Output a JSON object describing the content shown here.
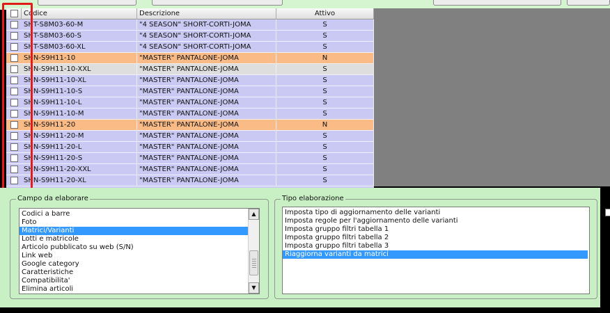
{
  "grid": {
    "columns": {
      "codice": "Codice",
      "descrizione": "Descrizione",
      "attivo": "Attivo"
    },
    "rows": [
      {
        "codice": "SHT-S8M03-60-M",
        "descrizione": "\"4 SEASON\"  SHORT-CORTI-JOMA",
        "attivo": "S",
        "state": "active"
      },
      {
        "codice": "SHT-S8M03-60-S",
        "descrizione": "\"4 SEASON\"  SHORT-CORTI-JOMA",
        "attivo": "S",
        "state": "active"
      },
      {
        "codice": "SHT-S8M03-60-XL",
        "descrizione": "\"4 SEASON\"  SHORT-CORTI-JOMA",
        "attivo": "S",
        "state": "active"
      },
      {
        "codice": "SHN-S9H11-10",
        "descrizione": "\"MASTER\"  PANTALONE-JOMA",
        "attivo": "N",
        "state": "inactive"
      },
      {
        "codice": "SHN-S9H11-10-XXL",
        "descrizione": "\"MASTER\"  PANTALONE-JOMA",
        "attivo": "S",
        "state": "current"
      },
      {
        "codice": "SHN-S9H11-10-XL",
        "descrizione": "\"MASTER\"  PANTALONE-JOMA",
        "attivo": "S",
        "state": "active"
      },
      {
        "codice": "SHN-S9H11-10-S",
        "descrizione": "\"MASTER\"  PANTALONE-JOMA",
        "attivo": "S",
        "state": "active"
      },
      {
        "codice": "SHN-S9H11-10-L",
        "descrizione": "\"MASTER\"  PANTALONE-JOMA",
        "attivo": "S",
        "state": "active"
      },
      {
        "codice": "SHN-S9H11-10-M",
        "descrizione": "\"MASTER\"  PANTALONE-JOMA",
        "attivo": "S",
        "state": "active"
      },
      {
        "codice": "SHN-S9H11-20",
        "descrizione": "\"MASTER\"  PANTALONE-JOMA",
        "attivo": "N",
        "state": "inactive"
      },
      {
        "codice": "SHN-S9H11-20-M",
        "descrizione": "\"MASTER\"  PANTALONE-JOMA",
        "attivo": "S",
        "state": "active"
      },
      {
        "codice": "SHN-S9H11-20-L",
        "descrizione": "\"MASTER\"  PANTALONE-JOMA",
        "attivo": "S",
        "state": "active"
      },
      {
        "codice": "SHN-S9H11-20-S",
        "descrizione": "\"MASTER\"  PANTALONE-JOMA",
        "attivo": "S",
        "state": "active"
      },
      {
        "codice": "SHN-S9H11-20-XXL",
        "descrizione": "\"MASTER\"  PANTALONE-JOMA",
        "attivo": "S",
        "state": "active"
      },
      {
        "codice": "SHN-S9H11-20-XL",
        "descrizione": "\"MASTER\"  PANTALONE-JOMA",
        "attivo": "S",
        "state": "active"
      }
    ]
  },
  "campo": {
    "title": "Campo da elaborare",
    "items": [
      "Codici a barre",
      "Foto",
      "Matrici/Varianti",
      "Lotti e matricole",
      "Articolo pubblicato su web (S/N)",
      "Link web",
      "Google category",
      "Caratteristiche",
      "Compatibilita'",
      "Elimina articoli"
    ],
    "selected": 2
  },
  "tipo": {
    "title": "Tipo elaborazione",
    "items": [
      "Imposta tipo di aggiornamento delle varianti",
      "Imposta regole per l'aggiornamento delle varianti",
      "Imposta gruppo filtri tabella 1",
      "Imposta gruppo filtri tabella 2",
      "Imposta gruppo filtri tabella 3",
      "Riaggiorna varianti da matrici"
    ],
    "selected": 5
  },
  "scrollbar": {
    "up_icon": "scroll-up-arrow-icon",
    "down_icon": "scroll-down-arrow-icon",
    "up_glyph": "▲",
    "down_glyph": "▼"
  },
  "colors": {
    "active_row": "#c9c9f3",
    "inactive_row": "#fbbb87",
    "current_row": "#dedede",
    "highlight": "#e21b1b",
    "panel": "#c9f0c4",
    "selection": "#3399ff"
  }
}
